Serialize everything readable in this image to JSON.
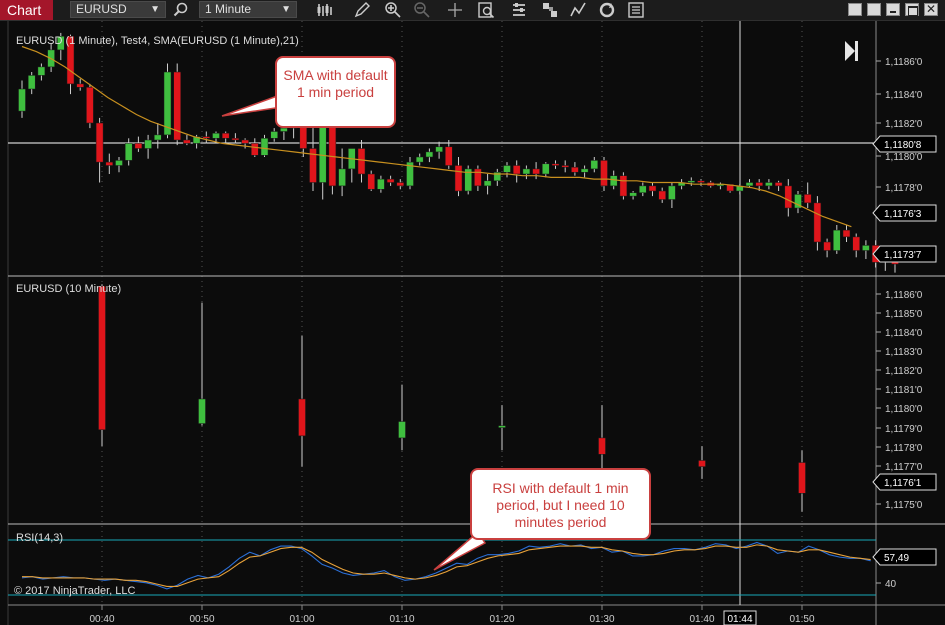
{
  "toolbar": {
    "tab_label": "Chart",
    "instrument": "EURUSD",
    "interval": "1 Minute",
    "icons": [
      "search-icon",
      "bar-style-icon",
      "draw-pencil-icon",
      "zoom-in-icon",
      "zoom-out-icon",
      "crosshair-icon",
      "data-box-icon",
      "indicators-icon",
      "strategies-icon",
      "drawing-tools-icon",
      "reload-icon",
      "properties-icon"
    ]
  },
  "panels": {
    "main_title": "EURUSD (1 Minute), Test4, SMA(EURUSD (1 Minute),21)",
    "ten_min_title": "EURUSD (10 Minute)",
    "rsi_title": "RSI(14,3)",
    "copyright": "© 2017 NinjaTrader, LLC"
  },
  "callouts": {
    "sma_note": "SMA with default 1 min period",
    "rsi_note": "RSI with default 1 min period, but I need 10 minutes period"
  },
  "chart_data": [
    {
      "type": "candlestick",
      "title": "EURUSD (1 Minute), Test4, SMA(EURUSD (1 Minute),21)",
      "y_tick_labels": [
        "1,1186'0",
        "1,1184'0",
        "1,1182'0",
        "1,1180'0",
        "1,1178'0"
      ],
      "ylim": [
        1.11725,
        1.11875
      ],
      "price_markers": [
        "1,1180'8",
        "1,1176'3",
        "1,1173'7"
      ],
      "colors": {
        "up": "#3fbf3f",
        "down": "#e0151b",
        "sma": "#c8901f"
      },
      "candles": [
        [
          1.11822,
          1.1184,
          1.11818,
          1.11835
        ],
        [
          1.11835,
          1.11845,
          1.11832,
          1.11843
        ],
        [
          1.11843,
          1.1185,
          1.1184,
          1.11848
        ],
        [
          1.11848,
          1.11862,
          1.11845,
          1.11858
        ],
        [
          1.11858,
          1.11868,
          1.11852,
          1.11866
        ],
        [
          1.11866,
          1.11867,
          1.11832,
          1.11838
        ],
        [
          1.11838,
          1.11841,
          1.11834,
          1.11836
        ],
        [
          1.11836,
          1.11838,
          1.11812,
          1.11815
        ],
        [
          1.11815,
          1.11818,
          1.1178,
          1.11792
        ],
        [
          1.11792,
          1.11797,
          1.11785,
          1.1179
        ],
        [
          1.1179,
          1.11795,
          1.11786,
          1.11793
        ],
        [
          1.11793,
          1.11806,
          1.1179,
          1.11803
        ],
        [
          1.11803,
          1.11807,
          1.11798,
          1.118
        ],
        [
          1.118,
          1.11808,
          1.11794,
          1.11805
        ],
        [
          1.11805,
          1.11815,
          1.118,
          1.11808
        ],
        [
          1.11808,
          1.1185,
          1.11806,
          1.11845
        ],
        [
          1.11845,
          1.1185,
          1.11802,
          1.11805
        ],
        [
          1.11805,
          1.11808,
          1.11802,
          1.11803
        ],
        [
          1.11803,
          1.11808,
          1.118,
          1.11807
        ],
        [
          1.11807,
          1.1181,
          1.11803,
          1.11806
        ],
        [
          1.11806,
          1.1181,
          1.11804,
          1.11809
        ],
        [
          1.11809,
          1.1181,
          1.11803,
          1.11806
        ],
        [
          1.11806,
          1.11809,
          1.11803,
          1.11805
        ],
        [
          1.11805,
          1.11806,
          1.118,
          1.11803
        ],
        [
          1.11803,
          1.11806,
          1.11795,
          1.11796
        ],
        [
          1.11796,
          1.11808,
          1.11795,
          1.11806
        ],
        [
          1.11806,
          1.11812,
          1.11804,
          1.1181
        ],
        [
          1.1181,
          1.11815,
          1.11805,
          1.11812
        ],
        [
          1.11812,
          1.1182,
          1.11806,
          1.11815
        ],
        [
          1.11815,
          1.11828,
          1.11795,
          1.118
        ],
        [
          1.118,
          1.11812,
          1.11775,
          1.1178
        ],
        [
          1.1178,
          1.11822,
          1.1177,
          1.11815
        ],
        [
          1.11815,
          1.1182,
          1.11773,
          1.11778
        ],
        [
          1.11778,
          1.118,
          1.11772,
          1.11788
        ],
        [
          1.11788,
          1.118,
          1.1178,
          1.118
        ],
        [
          1.118,
          1.11805,
          1.1178,
          1.11785
        ],
        [
          1.11785,
          1.11787,
          1.11775,
          1.11776
        ],
        [
          1.11776,
          1.11784,
          1.11774,
          1.11782
        ],
        [
          1.11782,
          1.11784,
          1.11778,
          1.1178
        ],
        [
          1.1178,
          1.11782,
          1.11776,
          1.11778
        ],
        [
          1.11778,
          1.11795,
          1.11776,
          1.11792
        ],
        [
          1.11792,
          1.11797,
          1.1179,
          1.11795
        ],
        [
          1.11795,
          1.118,
          1.11792,
          1.11798
        ],
        [
          1.11798,
          1.11804,
          1.11794,
          1.11801
        ],
        [
          1.11801,
          1.11805,
          1.11788,
          1.1179
        ],
        [
          1.1179,
          1.11795,
          1.11772,
          1.11775
        ],
        [
          1.11775,
          1.1179,
          1.11773,
          1.11788
        ],
        [
          1.11788,
          1.1179,
          1.11775,
          1.11778
        ],
        [
          1.11778,
          1.11785,
          1.11773,
          1.11781
        ],
        [
          1.11781,
          1.11788,
          1.11778,
          1.11786
        ],
        [
          1.11786,
          1.11792,
          1.11783,
          1.1179
        ],
        [
          1.1179,
          1.11793,
          1.1178,
          1.11785
        ],
        [
          1.11785,
          1.1179,
          1.11782,
          1.11788
        ],
        [
          1.11788,
          1.11792,
          1.11782,
          1.11785
        ],
        [
          1.11785,
          1.11792,
          1.11783,
          1.11791
        ],
        [
          1.11791,
          1.11793,
          1.11788,
          1.1179
        ],
        [
          1.1179,
          1.11793,
          1.11786,
          1.11789
        ],
        [
          1.11789,
          1.11792,
          1.11784,
          1.11786
        ],
        [
          1.11786,
          1.1179,
          1.11783,
          1.11788
        ],
        [
          1.11788,
          1.11795,
          1.11786,
          1.11793
        ],
        [
          1.11793,
          1.11795,
          1.11775,
          1.11778
        ],
        [
          1.11778,
          1.11787,
          1.11776,
          1.11784
        ],
        [
          1.11784,
          1.11786,
          1.1177,
          1.11772
        ],
        [
          1.11772,
          1.11775,
          1.1177,
          1.11774
        ],
        [
          1.11774,
          1.1178,
          1.11772,
          1.11778
        ],
        [
          1.11778,
          1.1178,
          1.11772,
          1.11775
        ],
        [
          1.11775,
          1.11777,
          1.11768,
          1.1177
        ],
        [
          1.1177,
          1.1178,
          1.11765,
          1.11778
        ],
        [
          1.11778,
          1.11782,
          1.11776,
          1.1178
        ],
        [
          1.1178,
          1.11783,
          1.11778,
          1.11781
        ],
        [
          1.11781,
          1.11782,
          1.11778,
          1.1178
        ],
        [
          1.1178,
          1.11781,
          1.11777,
          1.11778
        ],
        [
          1.11778,
          1.1178,
          1.11776,
          1.11779
        ],
        [
          1.11779,
          1.11779,
          1.11774,
          1.11775
        ],
        [
          1.11775,
          1.11779,
          1.11773,
          1.11778
        ],
        [
          1.11778,
          1.11782,
          1.11777,
          1.1178
        ],
        [
          1.1178,
          1.11782,
          1.11775,
          1.11778
        ],
        [
          1.11778,
          1.11782,
          1.11776,
          1.1178
        ],
        [
          1.1178,
          1.11781,
          1.11775,
          1.11778
        ],
        [
          1.11778,
          1.11782,
          1.1176,
          1.11765
        ],
        [
          1.11765,
          1.11775,
          1.11762,
          1.11773
        ],
        [
          1.11773,
          1.1178,
          1.11765,
          1.11768
        ],
        [
          1.11768,
          1.11772,
          1.1174,
          1.11745
        ],
        [
          1.11745,
          1.11747,
          1.11736,
          1.1174
        ],
        [
          1.1174,
          1.11755,
          1.11738,
          1.11752
        ],
        [
          1.11752,
          1.11755,
          1.11745,
          1.11748
        ],
        [
          1.11748,
          1.1175,
          1.11736,
          1.1174
        ],
        [
          1.1174,
          1.11746,
          1.11735,
          1.11743
        ],
        [
          1.11743,
          1.11746,
          1.1173,
          1.11733
        ],
        [
          1.11733,
          1.11742,
          1.11728,
          1.11738
        ],
        [
          1.11738,
          1.1174,
          1.11727,
          1.11732
        ]
      ],
      "sma": [
        1.1186,
        1.11857,
        1.11853,
        1.11848,
        1.11842,
        1.11836,
        1.1183,
        1.11825,
        1.1182,
        1.11816,
        1.11813,
        1.1181,
        1.11807,
        1.11805,
        1.11803,
        1.11802,
        1.11801,
        1.118,
        1.11799,
        1.11798,
        1.11797,
        1.11796,
        1.11795,
        1.11794,
        1.11793,
        1.11792,
        1.11791,
        1.1179,
        1.11789,
        1.11788,
        1.11787,
        1.11786,
        1.11786,
        1.11785,
        1.11785,
        1.11784,
        1.11784,
        1.11783,
        1.11783,
        1.11783,
        1.11782,
        1.11782,
        1.11781,
        1.11781,
        1.1178,
        1.1178,
        1.1178,
        1.11779,
        1.11779,
        1.11779,
        1.11778,
        1.11777,
        1.11775,
        1.11772,
        1.11768,
        1.11764,
        1.1176,
        1.11757,
        1.11754
      ]
    },
    {
      "type": "candlestick",
      "title": "EURUSD (10 Minute)",
      "x_tick_labels": [
        "00:40",
        "00:50",
        "01:00",
        "01:10",
        "01:20",
        "01:30",
        "01:40",
        "01:50"
      ],
      "y_tick_labels": [
        "1,1186'0",
        "1,1185'0",
        "1,1184'0",
        "1,1183'0",
        "1,1182'0",
        "1,1181'0",
        "1,1180'0",
        "1,1179'0",
        "1,1178'0",
        "1,1177'0",
        "1,1176'1",
        "1,1175'0"
      ],
      "ylim": [
        1.11744,
        1.11865
      ],
      "price_marker": "1,1176'1",
      "candles": [
        [
          1.1186,
          1.11861,
          1.11782,
          1.1179
        ],
        [
          1.11793,
          1.11852,
          1.11792,
          1.11805
        ],
        [
          1.11805,
          1.11836,
          1.11772,
          1.11787
        ],
        [
          1.11786,
          1.11812,
          1.1178,
          1.11794
        ],
        [
          1.11792,
          1.11802,
          1.1178,
          1.11792
        ],
        [
          1.11786,
          1.11802,
          1.1177,
          1.11778
        ],
        [
          1.11775,
          1.11782,
          1.11766,
          1.11772
        ],
        [
          1.11774,
          1.1178,
          1.1175,
          1.11759
        ]
      ]
    },
    {
      "type": "line",
      "title": "RSI(14,3)",
      "y_tick_labels": [
        "40"
      ],
      "current_value": "57,49",
      "series": [
        {
          "color": "#2b6fd6",
          "values": [
            44,
            45,
            43,
            44,
            45,
            44,
            44,
            43,
            42,
            43,
            42,
            41,
            40,
            38,
            35,
            38,
            43,
            46,
            44,
            47,
            53,
            60,
            65,
            62,
            67,
            70,
            70,
            68,
            62,
            55,
            52,
            48,
            46,
            47,
            48,
            50,
            45,
            42,
            43,
            45,
            48,
            52,
            56,
            55,
            60,
            63,
            63,
            64,
            66,
            70,
            69,
            70,
            72,
            70,
            71,
            68,
            69,
            65,
            66,
            62,
            62,
            63,
            66,
            68,
            68,
            67,
            69,
            72,
            71,
            68,
            70,
            73,
            70,
            64,
            66,
            65,
            70,
            67,
            63,
            61,
            60,
            60,
            58
          ]
        },
        {
          "color": "#e8a23a",
          "values": [
            45,
            45,
            44,
            44,
            44,
            44,
            44,
            43,
            43,
            43,
            42,
            42,
            41,
            39,
            37,
            37,
            40,
            43,
            44,
            45,
            50,
            56,
            61,
            62,
            65,
            68,
            69,
            69,
            65,
            59,
            55,
            51,
            48,
            47,
            47,
            48,
            46,
            44,
            43,
            44,
            46,
            49,
            53,
            54,
            57,
            60,
            62,
            63,
            64,
            67,
            68,
            69,
            70,
            70,
            70,
            69,
            69,
            67,
            66,
            64,
            63,
            63,
            64,
            66,
            67,
            67,
            68,
            70,
            70,
            69,
            69,
            71,
            70,
            67,
            66,
            65,
            67,
            67,
            65,
            63,
            61,
            60,
            59
          ]
        }
      ]
    }
  ]
}
